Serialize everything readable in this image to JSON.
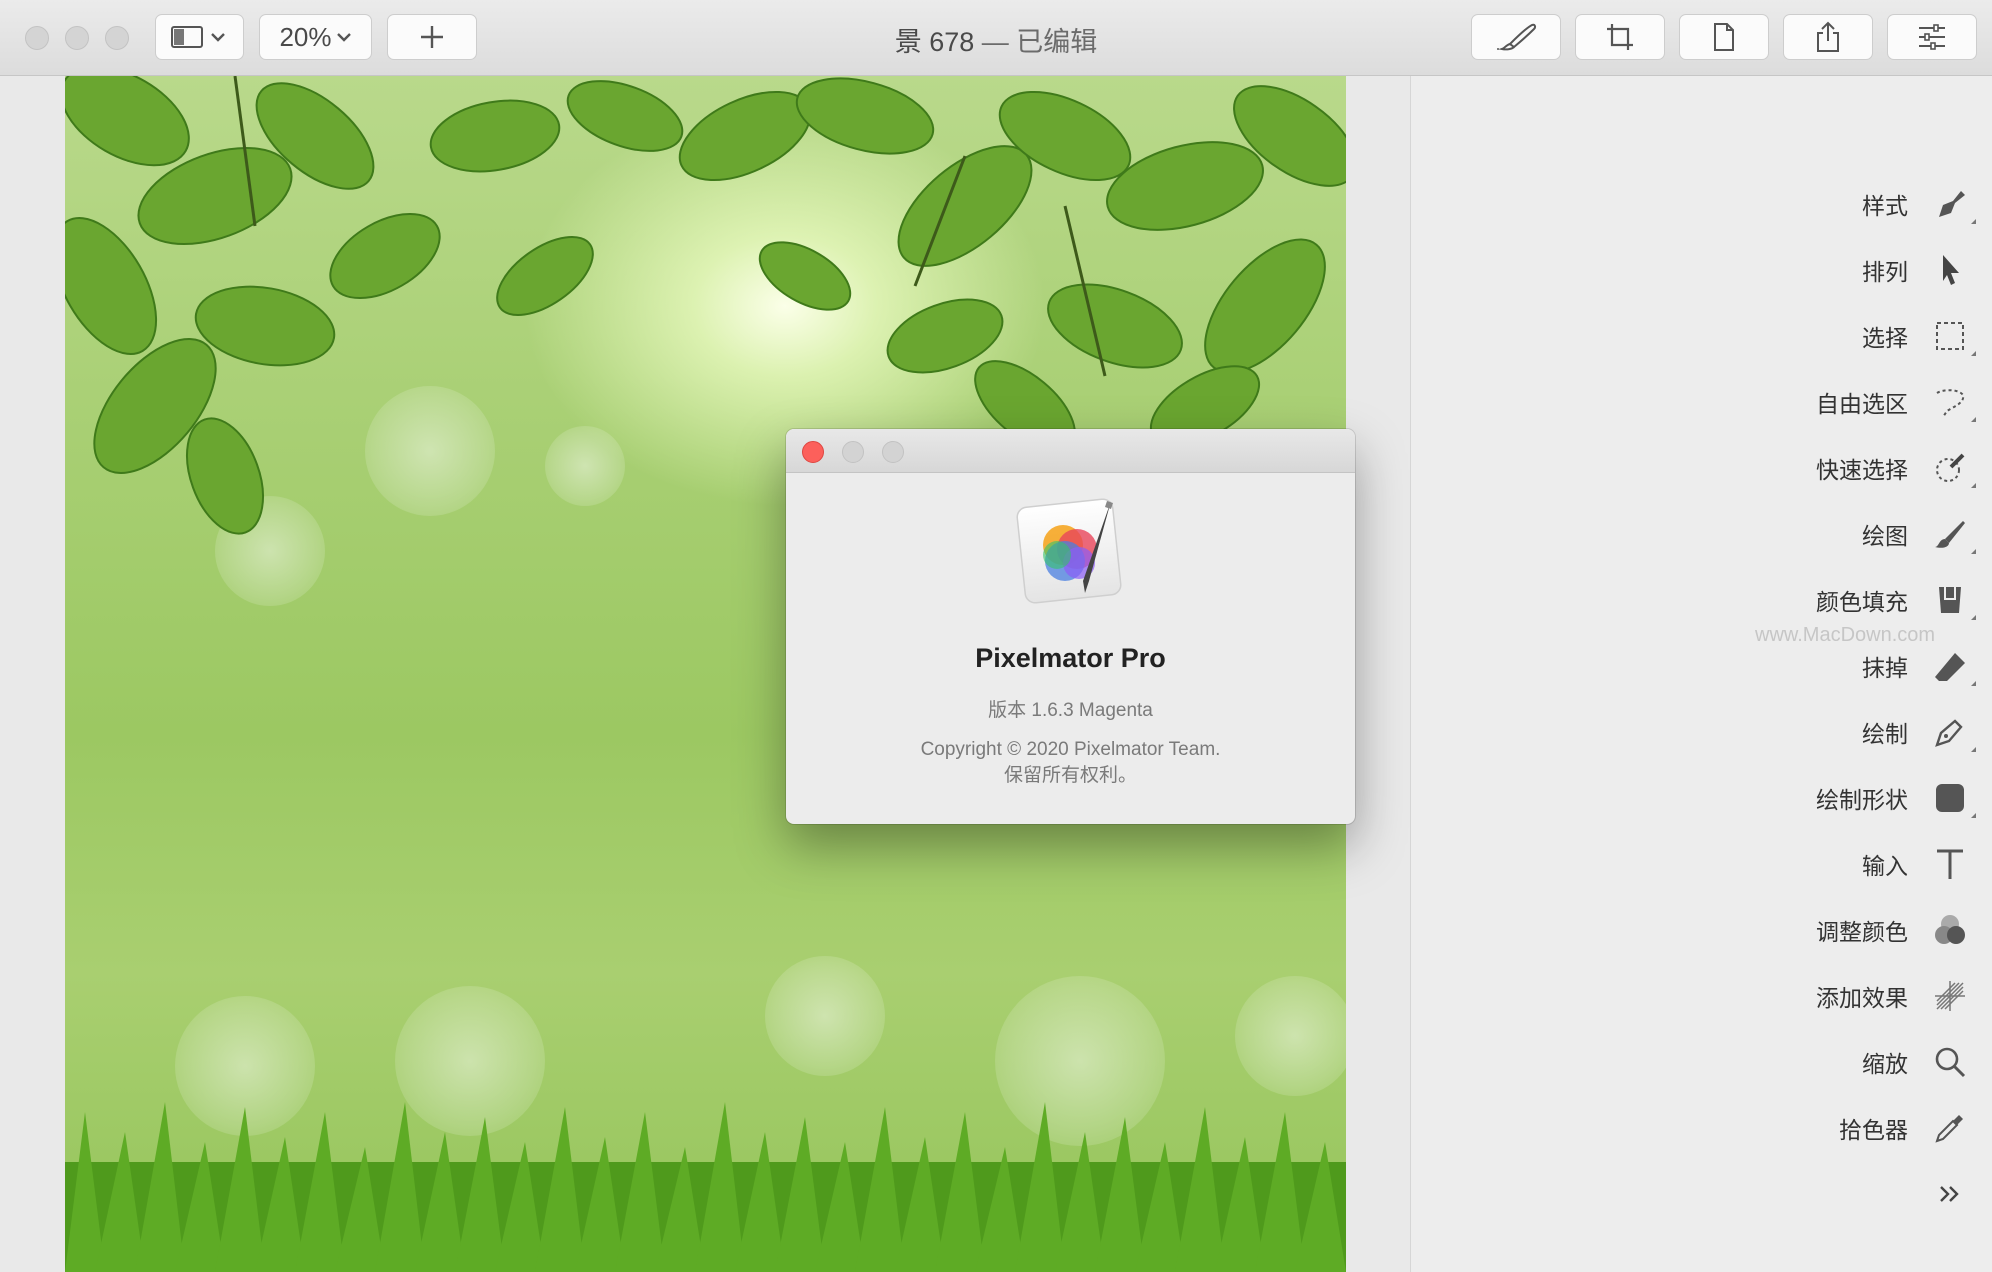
{
  "window": {
    "title_name": "景 678",
    "title_separator": " — ",
    "title_status": "已编辑"
  },
  "toolbar": {
    "zoom_value": "20%",
    "buttons": [
      "sidebar-toggle-icon",
      "add-icon",
      "paintbrush-icon",
      "crop-icon",
      "document-icon",
      "share-icon",
      "sliders-icon"
    ]
  },
  "about": {
    "app_name": "Pixelmator Pro",
    "version": "版本 1.6.3 Magenta",
    "copyright_line1": "Copyright © 2020 Pixelmator Team.",
    "copyright_line2": "保留所有权利。"
  },
  "sidebar": {
    "tools": [
      {
        "label": "样式",
        "icon": "style-icon"
      },
      {
        "label": "排列",
        "icon": "arrange-icon"
      },
      {
        "label": "选择",
        "icon": "selection-icon"
      },
      {
        "label": "自由选区",
        "icon": "lasso-icon"
      },
      {
        "label": "快速选择",
        "icon": "quick-selection-icon"
      },
      {
        "label": "绘图",
        "icon": "paint-brush-icon"
      },
      {
        "label": "颜色填充",
        "icon": "color-fill-icon"
      },
      {
        "label": "抹掉",
        "icon": "eraser-icon"
      },
      {
        "label": "绘制",
        "icon": "pen-icon"
      },
      {
        "label": "绘制形状",
        "icon": "shape-icon"
      },
      {
        "label": "输入",
        "icon": "type-icon"
      },
      {
        "label": "调整颜色",
        "icon": "adjust-color-icon"
      },
      {
        "label": "添加效果",
        "icon": "effects-icon"
      },
      {
        "label": "缩放",
        "icon": "zoom-icon"
      },
      {
        "label": "拾色器",
        "icon": "eyedropper-icon"
      }
    ],
    "watermark": "www.MacDown.com"
  }
}
